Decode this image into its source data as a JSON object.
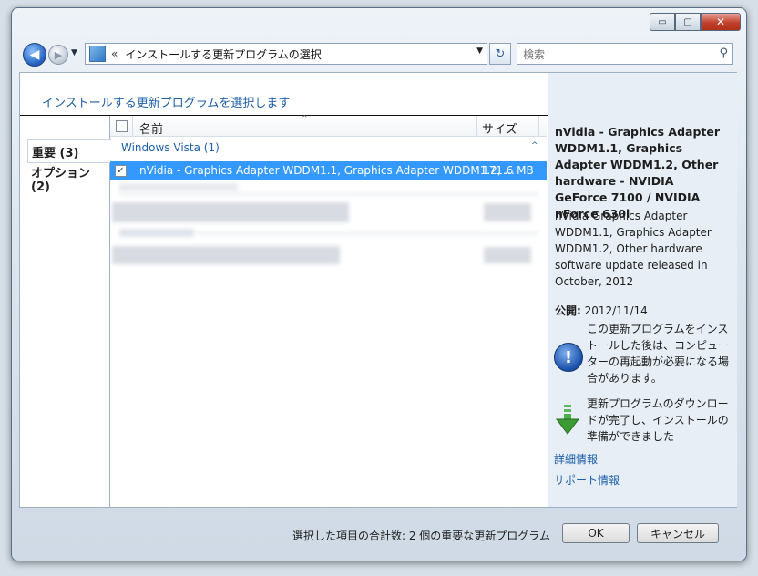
{
  "window": {
    "minimize": "▭",
    "maximize": "▢",
    "close": "✕"
  },
  "nav": {
    "back_glyph": "◀",
    "forward_glyph": "▶",
    "dropdown_glyph": "▼",
    "address_chevron": "«",
    "breadcrumb": "インストールする更新プログラムの選択",
    "address_dropdown": "▼",
    "refresh_glyph": "↻",
    "search_placeholder": "検索",
    "search_icon": "⚲"
  },
  "header": {
    "title": "インストールする更新プログラムを選択します"
  },
  "tabs": [
    {
      "label": "重要 (3)",
      "selected": true
    },
    {
      "label": "オプション (2)",
      "selected": false
    }
  ],
  "list": {
    "columns": {
      "name": "名前",
      "size": "サイズ",
      "sort_glyph": "^"
    },
    "group": {
      "label": "Windows Vista (1)",
      "collapse_glyph": "^"
    },
    "rows": [
      {
        "checked": true,
        "check_glyph": "✓",
        "name": "nVidia - Graphics Adapter WDDM1.1, Graphics Adapter WDDM1.2, ...",
        "size": "171.6 MB",
        "selected": true
      }
    ]
  },
  "details": {
    "title": "nVidia - Graphics Adapter WDDM1.1, Graphics Adapter WDDM1.2, Other hardware - NVIDIA GeForce 7100 / NVIDIA nForce 630i",
    "description": "nVidia Graphics Adapter WDDM1.1, Graphics Adapter WDDM1.2, Other hardware software update released in October, 2012",
    "published_label": "公開:",
    "published_date": "2012/11/14",
    "restart_notice": "この更新プログラムをインストールした後は、コンピューターの再起動が必要になる場合があります。",
    "download_notice": "更新プログラムのダウンロードが完了し、インストールの準備ができました",
    "info_glyph": "!",
    "link_more_info": "詳細情報",
    "link_support": "サポート情報"
  },
  "footer": {
    "summary": "選択した項目の合計数: 2 個の重要な更新プログラム",
    "ok": "OK",
    "cancel": "キャンセル"
  },
  "colors": {
    "accent": "#3399ff",
    "link": "#1d5fa8",
    "details_bg": "#e7eef6"
  }
}
